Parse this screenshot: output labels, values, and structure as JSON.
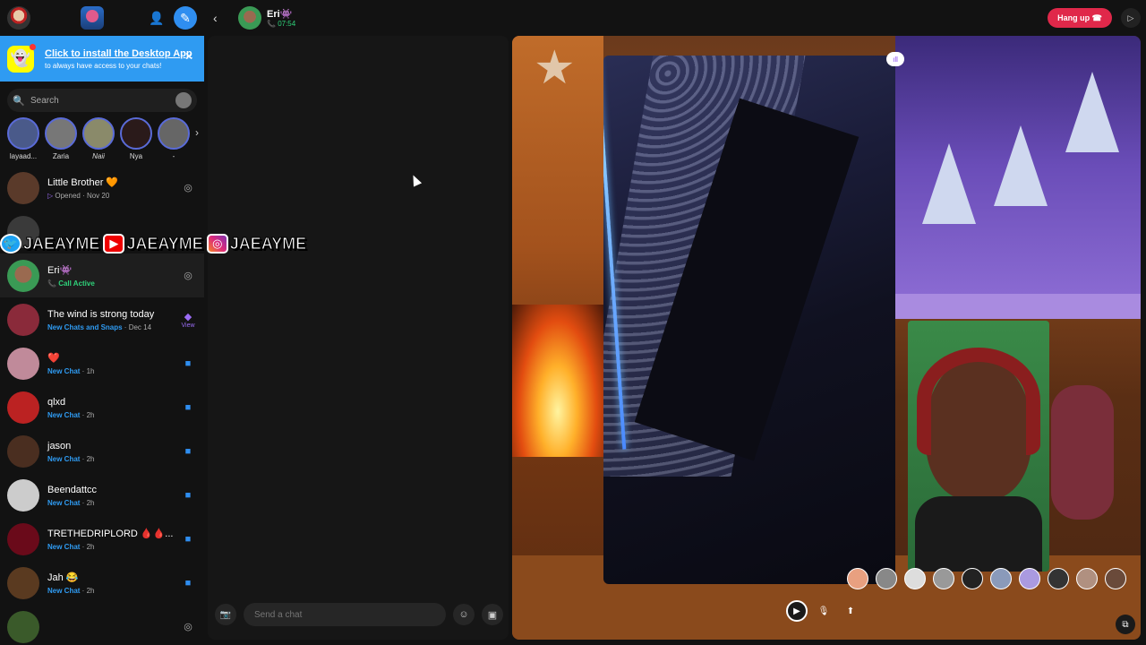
{
  "banner": {
    "title": "Click to install the Desktop App",
    "subtitle": "to always have access to your chats!"
  },
  "search": {
    "placeholder": "Search"
  },
  "stories": [
    {
      "label": "layaad..."
    },
    {
      "label": "Zaria"
    },
    {
      "label": "Naii"
    },
    {
      "label": "Nya"
    },
    {
      "label": "-"
    }
  ],
  "chats": [
    {
      "name": "Little Brother 🧡",
      "status": "Opened",
      "time": "Nov 20"
    },
    {
      "name": "Eri👾",
      "status": "Call Active",
      "time": ""
    },
    {
      "name": "The wind is strong today",
      "status": "New Chats and Snaps",
      "time": "Dec 14",
      "action": "View"
    },
    {
      "name": "❤️",
      "status": "New Chat",
      "time": "1h"
    },
    {
      "name": "qlxd",
      "status": "New Chat",
      "time": "2h"
    },
    {
      "name": "jason",
      "status": "New Chat",
      "time": "2h"
    },
    {
      "name": "Beendattcc",
      "status": "New Chat",
      "time": "2h"
    },
    {
      "name": "TRETHEDRIPLORD 🩸🩸...",
      "status": "New Chat",
      "time": "2h"
    },
    {
      "name": "Jah 😂",
      "status": "New Chat",
      "time": "2h"
    }
  ],
  "social_overlay": {
    "handle": "JAEAYME"
  },
  "header": {
    "name": "Eri👾",
    "call_time": "07:54",
    "hangup_label": "Hang up"
  },
  "composer": {
    "placeholder": "Send a chat"
  },
  "icons": {
    "camera": "camera-icon",
    "emoji": "emoji-icon",
    "sticker": "sticker-icon",
    "mic": "mic-icon",
    "video": "video-icon",
    "share": "share-screen-icon"
  },
  "colors": {
    "accent_blue": "#2f9bf2",
    "hangup_red": "#e0284a",
    "call_green": "#2fd27a",
    "snap_yellow": "#fffc00"
  }
}
